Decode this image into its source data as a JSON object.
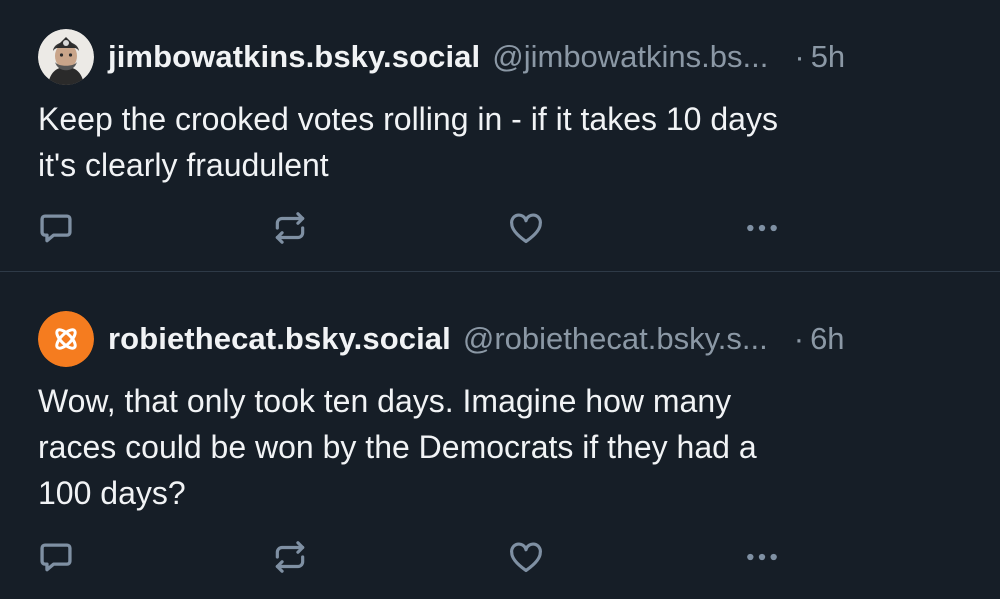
{
  "posts": [
    {
      "display_name": "jimbowatkins.bsky.social",
      "handle": "@jimbowatkins.bs...",
      "separator": "·",
      "time": "5h",
      "text": "Keep the crooked votes rolling in - if it takes 10 days\nit's clearly fraudulent",
      "avatar_icon": "portrait-avatar-icon"
    },
    {
      "display_name": "robiethecat.bsky.social",
      "handle": "@robiethecat.bsky.s...",
      "separator": "·",
      "time": "6h",
      "text": "Wow, that only took ten days. Imagine how many\nraces could be won by the Democrats if they had a\n100 days?",
      "avatar_icon": "orange-default-avatar-icon"
    }
  ],
  "actions": [
    "reply-icon",
    "repost-icon",
    "like-icon",
    "more-options-icon"
  ],
  "colors": {
    "background": "#161e27",
    "text_primary": "#f1f3f5",
    "text_secondary": "#8b98a5",
    "icon": "#7f90a3",
    "divider": "#2e3a47",
    "avatar_orange": "#f57c1f"
  }
}
